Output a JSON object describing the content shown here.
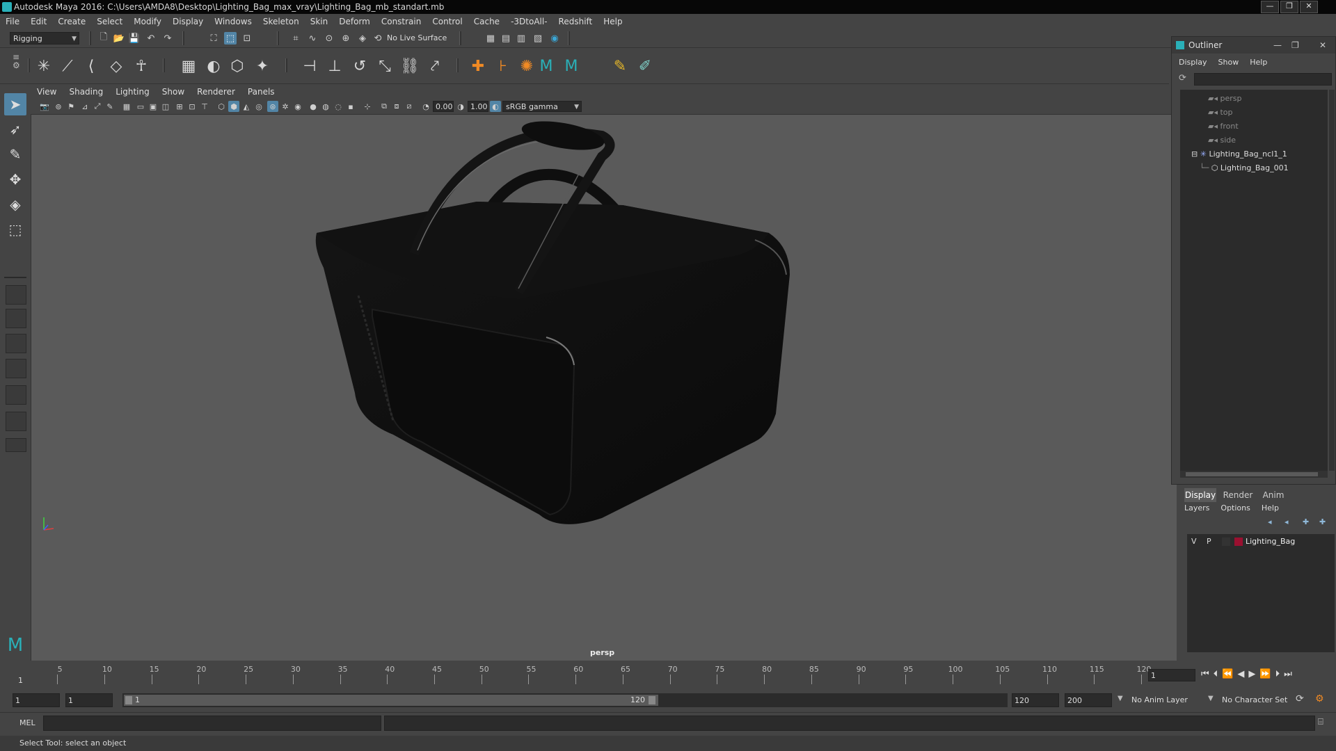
{
  "window": {
    "title": "Autodesk Maya 2016: C:\\Users\\AMDA8\\Desktop\\Lighting_Bag_max_vray\\Lighting_Bag_mb_standart.mb",
    "controls": [
      "—",
      "❐",
      "✕"
    ]
  },
  "menubar": [
    "File",
    "Edit",
    "Create",
    "Select",
    "Modify",
    "Display",
    "Windows",
    "Skeleton",
    "Skin",
    "Deform",
    "Constrain",
    "Control",
    "Cache",
    "-3DtoAll-",
    "Redshift",
    "Help"
  ],
  "statusline": {
    "menuset": "Rigging",
    "live_surface": "No Live Surface"
  },
  "viewport": {
    "menus": [
      "View",
      "Shading",
      "Lighting",
      "Show",
      "Renderer",
      "Panels"
    ],
    "exposure": "0.00",
    "gamma": "1.00",
    "color_space": "sRGB gamma",
    "camera_label": "persp",
    "bg_color": "#5a5a5a"
  },
  "outliner": {
    "title": "Outliner",
    "menus": [
      "Display",
      "Show",
      "Help"
    ],
    "items": [
      {
        "label": "persp",
        "type": "camera"
      },
      {
        "label": "top",
        "type": "camera"
      },
      {
        "label": "front",
        "type": "camera"
      },
      {
        "label": "side",
        "type": "camera"
      },
      {
        "label": "Lighting_Bag_ncl1_1",
        "type": "group",
        "expanded": true
      },
      {
        "label": "Lighting_Bag_001",
        "type": "mesh"
      }
    ]
  },
  "layer_editor": {
    "tabs": [
      "Display",
      "Render",
      "Anim"
    ],
    "active_tab": "Display",
    "menus": [
      "Layers",
      "Options",
      "Help"
    ],
    "layers": [
      {
        "visible": "V",
        "playback": "P",
        "color": "#9a1030",
        "name": "Lighting_Bag"
      }
    ]
  },
  "timeline": {
    "ticks": [
      "5",
      "10",
      "15",
      "20",
      "25",
      "30",
      "35",
      "40",
      "45",
      "50",
      "55",
      "60",
      "65",
      "70",
      "75",
      "80",
      "85",
      "90",
      "95",
      "100",
      "105",
      "110",
      "115",
      "120"
    ],
    "start_label": "1",
    "current_frame": "1"
  },
  "range": {
    "start": "1",
    "playback_start": "1",
    "slider_start": "1",
    "slider_end": "120",
    "playback_end": "120",
    "end": "200",
    "anim_layer": "No Anim Layer",
    "character_set": "No Character Set"
  },
  "command": {
    "lang": "MEL"
  },
  "helpline": "Select Tool: select an object",
  "colors": {
    "accent": "#5285a6",
    "maya_teal": "#2ab0b8"
  }
}
